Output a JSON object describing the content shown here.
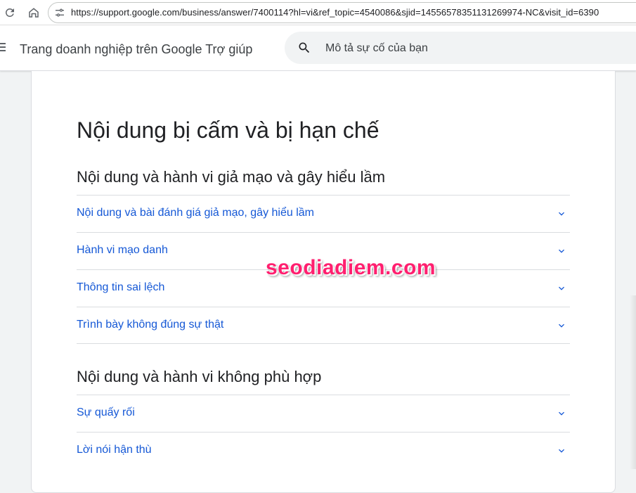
{
  "browser": {
    "url": "https://support.google.com/business/answer/7400114?hl=vi&ref_topic=4540086&sjid=14556578351131269974-NC&visit_id=6390"
  },
  "header": {
    "title": "Trang doanh nghiệp trên Google Trợ giúp",
    "search_placeholder": "Mô tả sự cố của bạn"
  },
  "article": {
    "title": "Nội dung bị cấm và bị hạn chế",
    "sections": [
      {
        "heading": "Nội dung và hành vi giả mạo và gây hiểu lầm",
        "items": [
          "Nội dung và bài đánh giá giả mạo, gây hiểu lầm",
          "Hành vi mạo danh",
          "Thông tin sai lệch",
          "Trình bày không đúng sự thật"
        ]
      },
      {
        "heading": "Nội dung và hành vi không phù hợp",
        "items": [
          "Sự quấy rối",
          "Lời nói hận thù"
        ]
      }
    ]
  },
  "watermark": "seodiadiem.com",
  "colors": {
    "link": "#1558d6",
    "watermark": "#ff1f6f",
    "divider": "#dadce0"
  }
}
